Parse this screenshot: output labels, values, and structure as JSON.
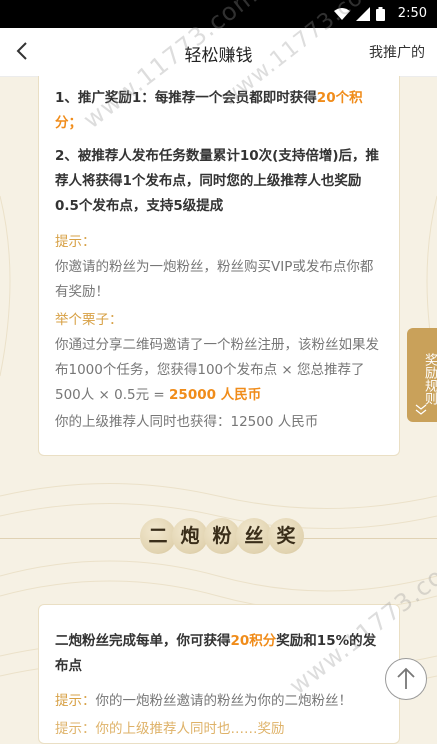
{
  "status_bar": {
    "time": "2:50"
  },
  "header": {
    "title": "轻松赚钱",
    "right_link": "我推广的"
  },
  "card1": {
    "item1_prefix": "1、推广奖励1：每推荐一个会员都即时获得",
    "item1_highlight": "20个积分；",
    "item2": "2、被推荐人发布任务数量累计10次(支持倍增)后，推荐人将获得1个发布点，同时您的上级推荐人也奖励0.5个发布点，支持5级提成",
    "tip_label": "提示：",
    "tip_text": "你邀请的粉丝为一炮粉丝，粉丝购买VIP或发布点你都有奖励！",
    "example_label": "举个栗子：",
    "example_text": "你通过分享二维码邀请了一个粉丝注册，该粉丝如果发布1000个任务，您获得100个发布点 × 您总推荐了500人 × 0.5元 = ",
    "example_result": "25000 人民币",
    "upline_text": "你的上级推荐人同时也获得：12500 人民币"
  },
  "section2": {
    "chars": [
      "二",
      "炮",
      "粉",
      "丝",
      "奖"
    ]
  },
  "card2": {
    "line_prefix": "二炮粉丝完成每单，你可获得",
    "line_highlight": "20积分",
    "line_suffix": "奖励和15%的发布点",
    "tip_label": "提示：",
    "tip_text": "你的一炮粉丝邀请的粉丝为你的二炮粉丝！",
    "cut_line": "提示：你的上级推荐人同时也……奖励"
  },
  "rule_tab": {
    "label": "奖励规则"
  },
  "watermarks": [
    "www.11773.com",
    "www.11773.com",
    "www.11773.com"
  ],
  "colors": {
    "accent_orange": "#f08c1a",
    "accent_gold": "#c9a15a",
    "background": "#f6f1e4"
  }
}
